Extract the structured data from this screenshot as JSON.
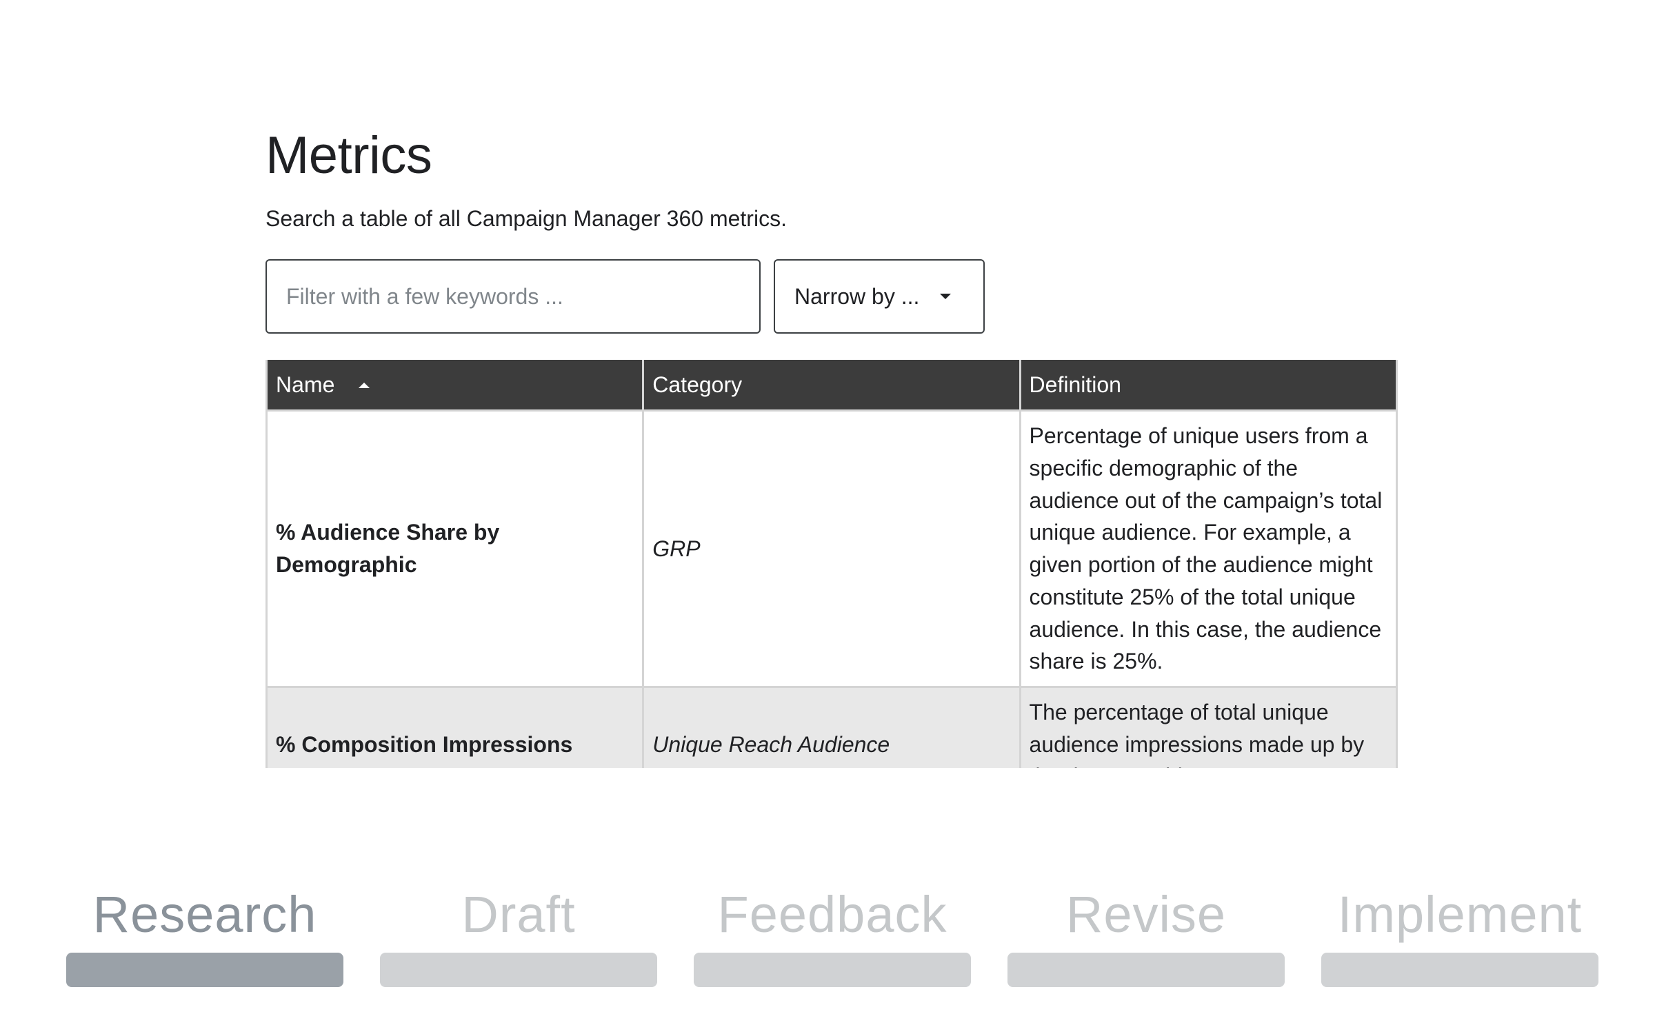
{
  "page": {
    "title": "Metrics",
    "subtitle": "Search a table of all Campaign Manager 360 metrics."
  },
  "filter": {
    "placeholder": "Filter with a few keywords ...",
    "value": ""
  },
  "narrow": {
    "label": "Narrow by ..."
  },
  "table": {
    "columns": [
      "Name",
      "Category",
      "Definition"
    ],
    "sort_column": "Name",
    "sort_direction": "ascending",
    "rows": [
      {
        "name": "% Audience Share by Demographic",
        "category": "GRP",
        "definition": "Percentage of unique users from a specific demographic of the audience out of the campaign’s total unique audience. For example, a given portion of the audience might constitute 25% of the total unique audience. In this case, the audience share is 25%."
      },
      {
        "name": "% Composition Impressions",
        "category": "Unique Reach Audience",
        "definition": "The percentage of total unique audience impressions made up by the demographic."
      }
    ]
  },
  "steps": [
    {
      "label": "Research",
      "active": true
    },
    {
      "label": "Draft",
      "active": false
    },
    {
      "label": "Feedback",
      "active": false
    },
    {
      "label": "Revise",
      "active": false
    },
    {
      "label": "Implement",
      "active": false
    }
  ],
  "colors": {
    "header_bg": "#3c3c3c",
    "alt_row_bg": "#e8e8e8",
    "active_step": "#9aa1a8",
    "inactive_step": "#d0d2d4"
  }
}
